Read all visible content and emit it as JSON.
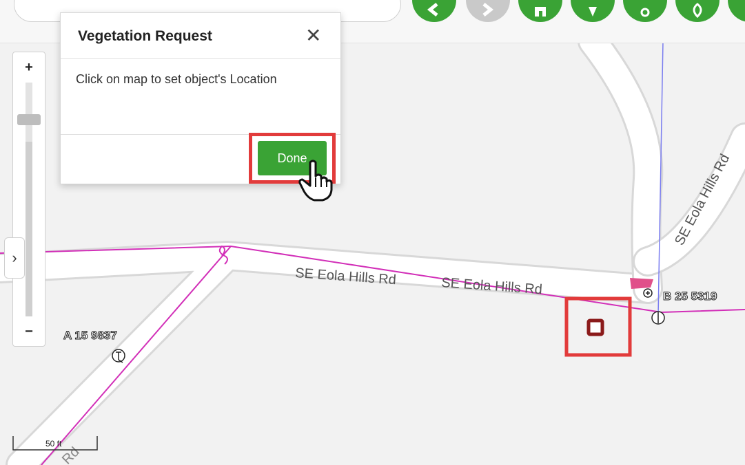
{
  "dialog": {
    "title": "Vegetation Request",
    "close_symbol": "✕",
    "message": "Click on map to set object's Location",
    "done_label": "Done"
  },
  "zoom": {
    "in_label": "+",
    "out_label": "−"
  },
  "panel_toggle": {
    "label": "›"
  },
  "map": {
    "road_labels": [
      "SE Eola Hills Rd",
      "SE Eola Hills Rd",
      "SE Eola Hills Rd",
      "Rd"
    ],
    "asset_labels": [
      "A 15 9837",
      "B 25 5319"
    ]
  },
  "scale": {
    "label": "50 ft"
  },
  "toolbar_icons": [
    "search-icon",
    "back-icon",
    "forward-icon",
    "home-icon",
    "location-icon",
    "edit-icon",
    "vegetation-icon"
  ],
  "colors": {
    "accent_green": "#3aa335",
    "highlight_red": "#e23b3b",
    "line_magenta": "#d22fb8",
    "line_blue": "#7a7df0",
    "marker_dark_red": "#8b1a1a"
  }
}
